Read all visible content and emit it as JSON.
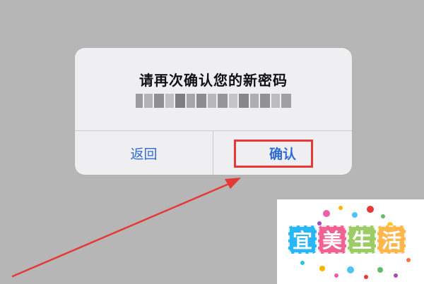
{
  "dialog": {
    "title": "请再次确认您的新密码",
    "message_masked": true
  },
  "buttons": {
    "back_label": "返回",
    "confirm_label": "确认"
  },
  "watermark": {
    "text": "宜美生活"
  },
  "colors": {
    "button_text": "#2f6bd6",
    "highlight": "#e53935",
    "overlay": "#b6b6b6",
    "dialog_bg": "#efeff2"
  }
}
